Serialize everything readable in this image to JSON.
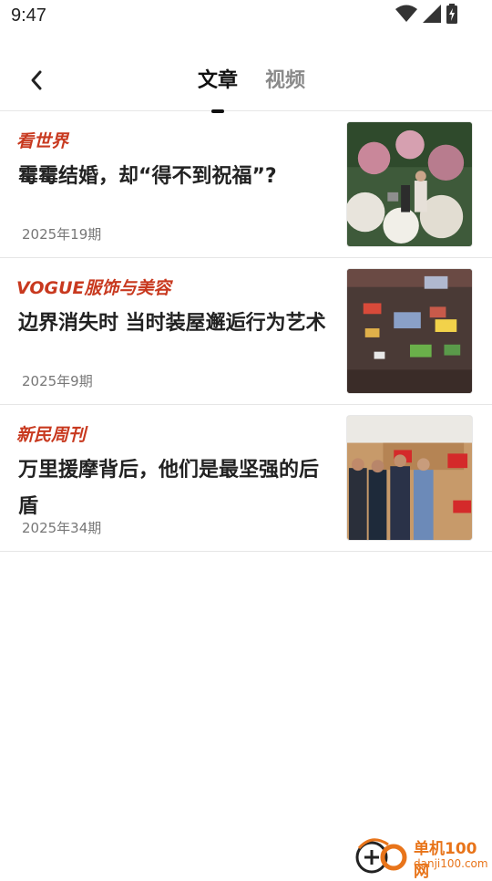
{
  "status_bar": {
    "time": "9:47",
    "icons": [
      "wifi-icon",
      "signal-icon",
      "battery-icon"
    ]
  },
  "header": {
    "back_icon": "chevron-left-icon",
    "tabs": [
      {
        "label": "文章",
        "active": true
      },
      {
        "label": "视频",
        "active": false
      }
    ]
  },
  "articles": [
    {
      "source": "看世界",
      "title": "霉霉结婚，却“得不到祝福”?",
      "issue": "2025年19期",
      "thumb": "garden-wedding-photo"
    },
    {
      "source": "VOGUE服饰与美容",
      "title": "边界消失时 当时装屋邂逅行为艺术",
      "issue": "2025年9期",
      "thumb": "gallery-screens-photo"
    },
    {
      "source": "新民周刊",
      "title": "万里援摩背后，他们是最坚强的后盾",
      "issue": "2025年34期",
      "thumb": "group-photo"
    }
  ],
  "watermark": {
    "name": "单机100网",
    "url": "danji100.com"
  },
  "colors": {
    "source_red": "#c8391f",
    "watermark_orange": "#e8741a"
  }
}
